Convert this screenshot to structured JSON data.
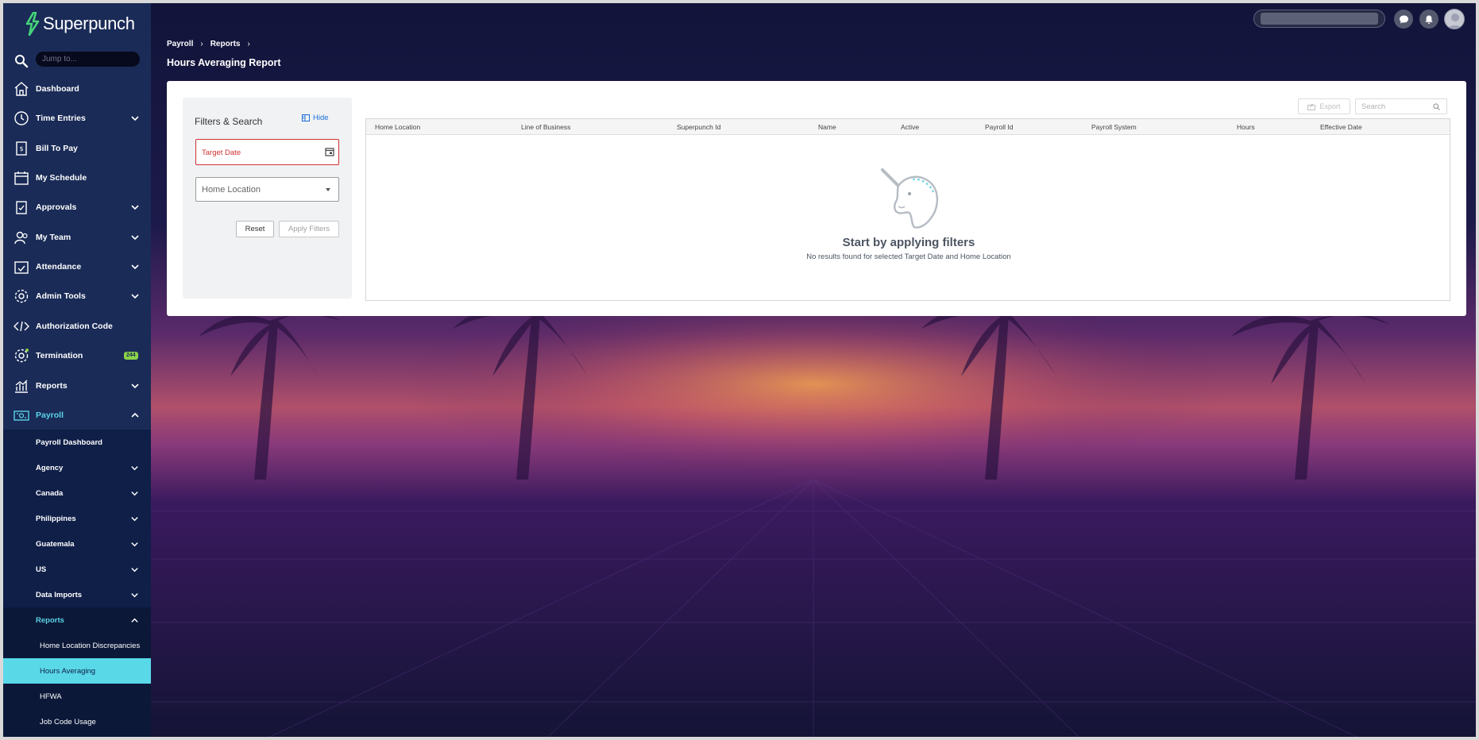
{
  "app": {
    "brand": "Superpunch",
    "jump_placeholder": "Jump to..."
  },
  "sidebar": {
    "items": [
      {
        "label": "Dashboard"
      },
      {
        "label": "Time Entries"
      },
      {
        "label": "Bill To Pay"
      },
      {
        "label": "My Schedule"
      },
      {
        "label": "Approvals"
      },
      {
        "label": "My Team"
      },
      {
        "label": "Attendance"
      },
      {
        "label": "Admin Tools"
      },
      {
        "label": "Authorization Code"
      },
      {
        "label": "Termination",
        "badge": "244"
      },
      {
        "label": "Reports"
      },
      {
        "label": "Payroll"
      }
    ],
    "payroll_sub": [
      {
        "label": "Payroll Dashboard"
      },
      {
        "label": "Agency"
      },
      {
        "label": "Canada"
      },
      {
        "label": "Philippines"
      },
      {
        "label": "Guatemala"
      },
      {
        "label": "US"
      },
      {
        "label": "Data Imports"
      },
      {
        "label": "Reports"
      }
    ],
    "reports_sub": [
      {
        "label": "Home Location Discrepancies"
      },
      {
        "label": "Hours Averaging"
      },
      {
        "label": "HFWA"
      },
      {
        "label": "Job Code Usage"
      }
    ]
  },
  "header": {
    "breadcrumb": [
      "Payroll",
      "Reports"
    ],
    "title": "Hours Averaging Report"
  },
  "filters": {
    "title": "Filters & Search",
    "hide_label": "Hide",
    "target_date_placeholder": "Target Date",
    "home_location_placeholder": "Home Location",
    "reset_label": "Reset",
    "apply_label": "Apply Filters"
  },
  "table": {
    "export_label": "Export",
    "search_placeholder": "Search",
    "columns": [
      "Home Location",
      "Line of Business",
      "Superpunch Id",
      "Name",
      "Active",
      "Payroll Id",
      "Payroll System",
      "Hours",
      "Effective Date"
    ],
    "empty_title": "Start by applying filters",
    "empty_subtitle": "No results found for selected Target Date and Home Location"
  },
  "colors": {
    "sidebar_bg": "#1a2b57",
    "accent": "#59d8e8",
    "error": "#d03030",
    "link": "#1d6fd8",
    "badge": "#8ad24a"
  }
}
